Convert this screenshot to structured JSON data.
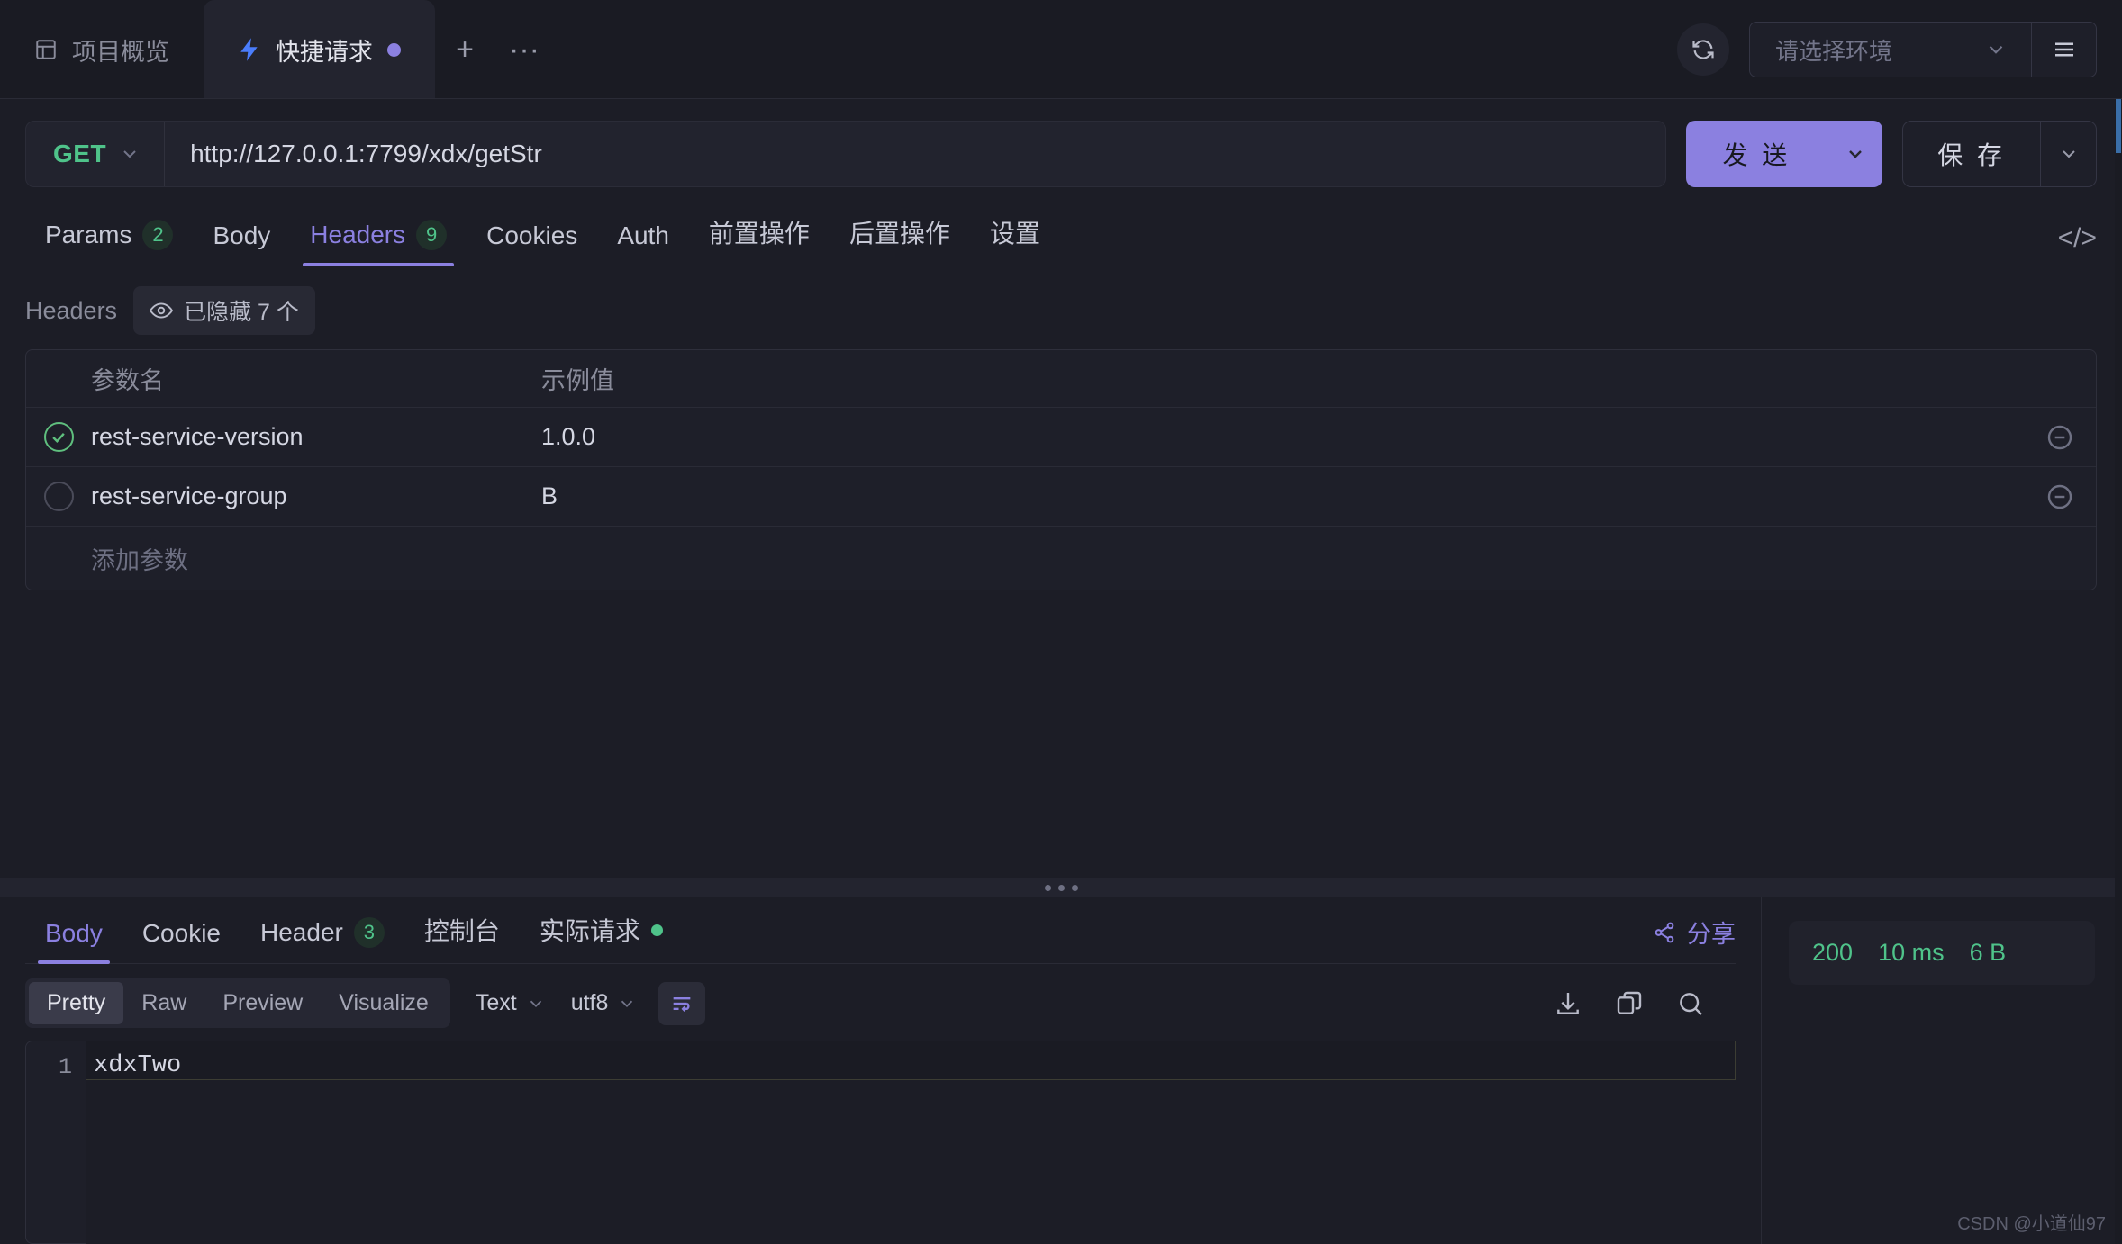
{
  "window_tabs": [
    {
      "label": "项目概览",
      "icon": "layout-icon",
      "active": false,
      "dirty": false
    },
    {
      "label": "快捷请求",
      "icon": "bolt-icon",
      "active": true,
      "dirty": true
    }
  ],
  "tabbar_actions": {
    "add": "+",
    "more": "···"
  },
  "header_right": {
    "refresh_icon": "refresh-icon",
    "env_placeholder": "请选择环境",
    "env_chevron": "chevron-down-icon",
    "menu_icon": "hamburger-menu-icon"
  },
  "request": {
    "method": "GET",
    "method_chevron": "chevron-down-icon",
    "url": "http://127.0.0.1:7799/xdx/getStr",
    "send_label": "发 送",
    "send_chevron": "chevron-down-icon",
    "save_label": "保 存",
    "save_chevron": "chevron-down-icon"
  },
  "request_tabs": [
    {
      "label": "Params",
      "count": "2",
      "active": false
    },
    {
      "label": "Body",
      "count": "",
      "active": false
    },
    {
      "label": "Headers",
      "count": "9",
      "active": true
    },
    {
      "label": "Cookies",
      "count": "",
      "active": false
    },
    {
      "label": "Auth",
      "count": "",
      "active": false
    },
    {
      "label": "前置操作",
      "count": "",
      "active": false
    },
    {
      "label": "后置操作",
      "count": "",
      "active": false
    },
    {
      "label": "设置",
      "count": "",
      "active": false
    }
  ],
  "code_icon": "</>",
  "headers_panel": {
    "title": "Headers",
    "hidden_chip": {
      "icon": "eye-icon",
      "label": "已隐藏 7 个"
    },
    "columns": {
      "name": "参数名",
      "value": "示例值"
    },
    "rows": [
      {
        "enabled": true,
        "name": "rest-service-version",
        "value": "1.0.0",
        "remove_icon": "minus-circle-icon"
      },
      {
        "enabled": false,
        "name": "rest-service-group",
        "value": "B",
        "remove_icon": "minus-circle-icon"
      }
    ],
    "add_row_label": "添加参数"
  },
  "response_tabs": [
    {
      "label": "Body",
      "count": "",
      "active": true,
      "dot": false
    },
    {
      "label": "Cookie",
      "count": "",
      "active": false,
      "dot": false
    },
    {
      "label": "Header",
      "count": "3",
      "active": false,
      "dot": false
    },
    {
      "label": "控制台",
      "count": "",
      "active": false,
      "dot": false
    },
    {
      "label": "实际请求",
      "count": "",
      "active": false,
      "dot": true
    }
  ],
  "share": {
    "icon": "share-icon",
    "label": "分享"
  },
  "viewer": {
    "modes": [
      {
        "label": "Pretty",
        "active": true
      },
      {
        "label": "Raw",
        "active": false
      },
      {
        "label": "Preview",
        "active": false
      },
      {
        "label": "Visualize",
        "active": false
      }
    ],
    "content_type": "Text",
    "content_type_chevron": "chevron-down-icon",
    "encoding": "utf8",
    "encoding_chevron": "chevron-down-icon",
    "wrap_icon": "wrap-lines-icon",
    "actions": [
      "download-icon",
      "copy-icon",
      "search-icon"
    ]
  },
  "body": {
    "line_numbers": [
      "1"
    ],
    "lines": [
      "xdxTwo"
    ]
  },
  "status": {
    "code": "200",
    "time": "10 ms",
    "size": "6 B"
  },
  "watermark": "CSDN @小道仙97",
  "colors": {
    "accent": "#8b80e0",
    "success": "#4fc38a",
    "bg": "#1c1d26",
    "panel": "#1e1f29"
  }
}
